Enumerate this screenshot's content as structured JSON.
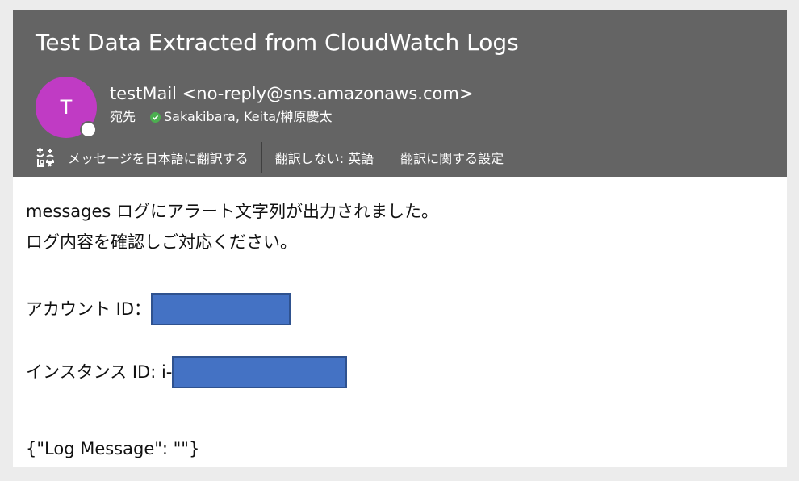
{
  "email": {
    "subject": "Test Data Extracted from CloudWatch Logs",
    "avatar_initial": "T",
    "sender": "testMail <no-reply@sns.amazonaws.com>",
    "to_label": "宛先",
    "recipient": "Sakakibara, Keita/榊原慶太"
  },
  "translate_bar": {
    "translate_label": "メッセージを日本語に翻訳する",
    "dont_translate_label": "翻訳しない: 英語",
    "settings_label": "翻訳に関する設定"
  },
  "body": {
    "line1": "messages ログにアラート文字列が出力されました。",
    "line2": "ログ内容を確認しご対応ください。",
    "account_label": "アカウント ID：",
    "instance_label": "インスタンス ID: i-",
    "log_message": "{\"Log Message\": \"\"}"
  },
  "colors": {
    "header_bg": "#646464",
    "avatar_bg": "#c03bc4",
    "verified_green": "#4caf50",
    "redaction_fill": "#4472c4"
  }
}
